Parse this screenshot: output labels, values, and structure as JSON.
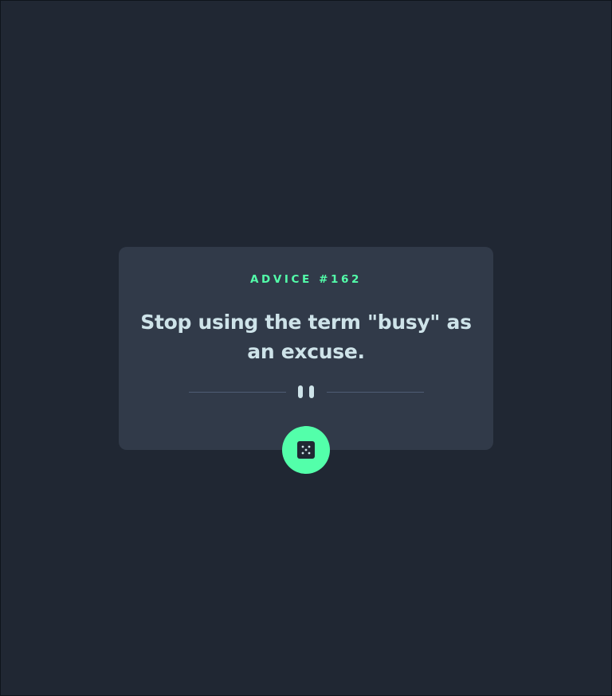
{
  "advice": {
    "id_label": "ADVICE #162",
    "text": "Stop using the term \"busy\" as an excuse."
  },
  "icons": {
    "divider": "pause-icon",
    "generate": "dice-icon"
  },
  "colors": {
    "background": "#202733",
    "card": "#313a49",
    "accent": "#53ffaa",
    "text": "#cee3e9",
    "divider": "#4f5d74"
  }
}
